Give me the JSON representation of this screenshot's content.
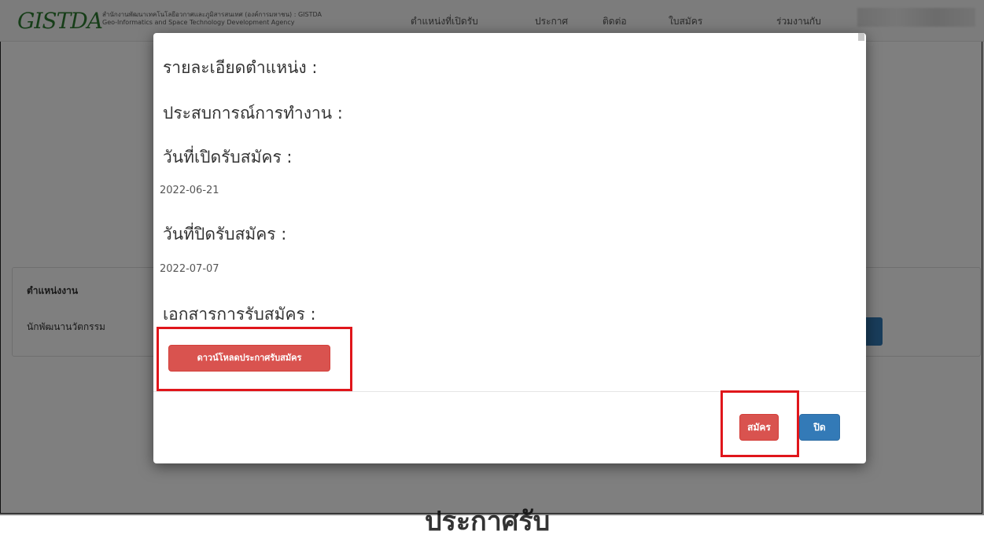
{
  "navbar": {
    "logo": "GISTDA",
    "logo_text": "สำนักงานพัฒนาเทคโนโลยีอวกาศและภูมิสารสนเทศ (องค์การมหาชน) : GISTDA",
    "logo_subtext": "Geo-Informatics and Space Technology Development Agency",
    "items": [
      "ตำแหน่งที่เปิดรับ",
      "ประกาศ",
      "ติดต่อ",
      "ใบสมัคร",
      "ร่วมงานกับ"
    ]
  },
  "background": {
    "table_header": "ตำแหน่งงาน",
    "table_row": "นักพัฒนานวัตกรรม",
    "big_title": "ประกาศรับ"
  },
  "modal": {
    "job_detail_label": "รายละเอียดตำแหน่ง :",
    "experience_label": "ประสบการณ์การทำงาน :",
    "open_date_label": "วันที่เปิดรับสมัคร :",
    "open_date": "2022-06-21",
    "close_date_label": "วันที่ปิดรับสมัคร :",
    "close_date": "2022-07-07",
    "documents_label": "เอกสารการรับสมัคร :",
    "download_button": "ดาวน์โหลดประกาศรับสมัคร",
    "apply_button": "สมัคร",
    "close_button": "ปิด"
  },
  "colors": {
    "danger": "#d9534f",
    "primary": "#337ab7",
    "highlight": "#e0161b"
  }
}
